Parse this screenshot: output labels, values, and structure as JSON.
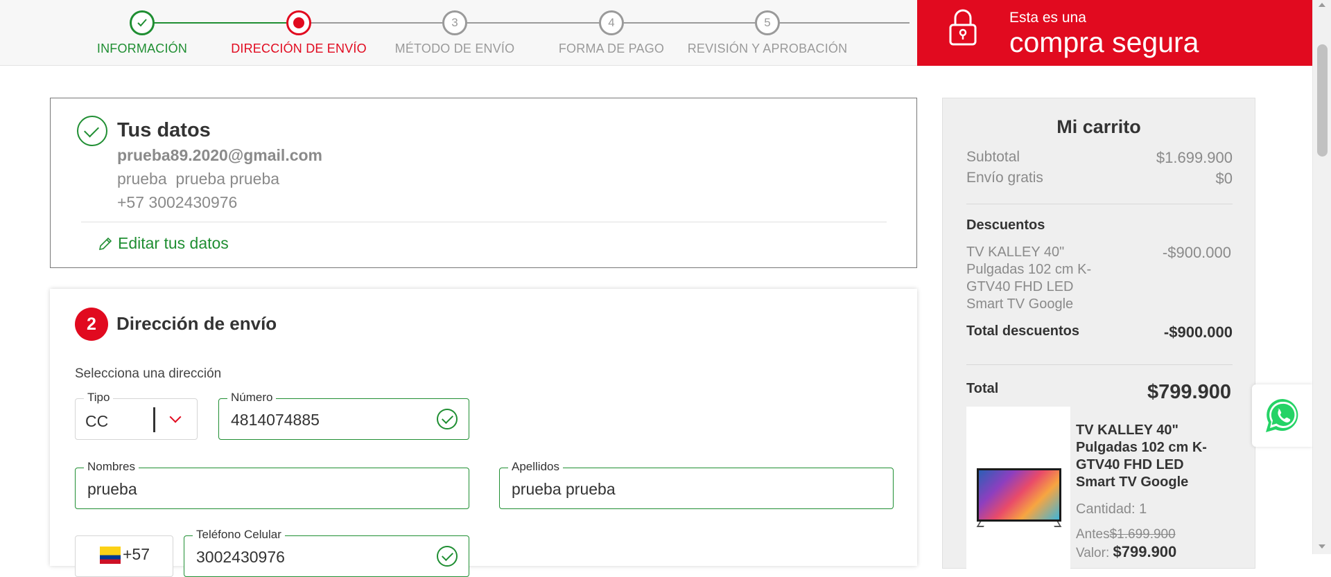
{
  "steps": [
    {
      "number": "✓",
      "label": "INFORMACIÓN",
      "state": "done"
    },
    {
      "number": "",
      "label": "DIRECCIÓN DE ENVÍO",
      "state": "current"
    },
    {
      "number": "3",
      "label": "MÉTODO DE ENVÍO",
      "state": "pending"
    },
    {
      "number": "4",
      "label": "FORMA DE PAGO",
      "state": "pending"
    },
    {
      "number": "5",
      "label": "REVISIÓN Y APROBACIÓN",
      "state": "pending"
    }
  ],
  "secure_banner": {
    "small_text": "Esta es una",
    "big_text": "compra segura",
    "icon": "padlock-icon"
  },
  "tus_datos": {
    "title": "Tus datos",
    "email": "prueba89.2020@gmail.com",
    "full_name": "prueba  prueba prueba",
    "phone": "+57 3002430976",
    "edit_label": "Editar tus datos",
    "icon": "check-circle-icon"
  },
  "direccion": {
    "step_number": "2",
    "title": "Dirección de envío",
    "subtitle": "Selecciona una dirección",
    "tipo": {
      "label": "Tipo",
      "value": "CC"
    },
    "numero": {
      "label": "Número",
      "value": "4814074885"
    },
    "nombres": {
      "label": "Nombres",
      "value": "prueba"
    },
    "apellidos": {
      "label": "Apellidos",
      "value": "prueba prueba"
    },
    "country_code": "+57",
    "telefono": {
      "label": "Teléfono Celular",
      "value": "3002430976"
    }
  },
  "cart": {
    "title": "Mi carrito",
    "subtotal_label": "Subtotal",
    "subtotal_value": "$1.699.900",
    "shipping_label": "Envío gratis",
    "shipping_value": "$0",
    "discounts_label": "Descuentos",
    "discount_item_name": "TV KALLEY 40\" Pulgadas 102 cm K-GTV40 FHD LED Smart TV Google",
    "discount_item_value": "-$900.000",
    "total_discounts_label": "Total descuentos",
    "total_discounts_value": "-$900.000",
    "total_label": "Total",
    "total_value": "$799.900",
    "product": {
      "name": "TV KALLEY 40\" Pulgadas 102 cm K-GTV40 FHD LED Smart TV Google",
      "quantity": "Cantidad: 1",
      "before_label": "Antes",
      "before_value": "$1.699.900",
      "value_label": "Valor:",
      "value": "$799.900"
    }
  },
  "whatsapp": {
    "icon": "whatsapp-icon"
  },
  "colors": {
    "accent_red": "#e10a1f",
    "success_green": "#1f8e32"
  }
}
